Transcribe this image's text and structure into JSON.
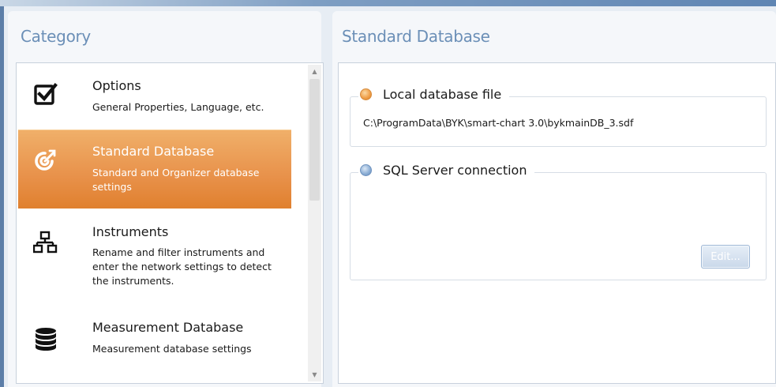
{
  "category": {
    "title": "Category",
    "items": [
      {
        "icon": "checkbox-icon",
        "title": "Options",
        "desc": "General Properties, Language, etc.",
        "selected": false
      },
      {
        "icon": "target-sync-icon",
        "title": "Standard Database",
        "desc": "Standard and Organizer database settings",
        "selected": true
      },
      {
        "icon": "network-icon",
        "title": "Instruments",
        "desc": "Rename and filter instruments and enter the network settings to detect the instruments.",
        "selected": false
      },
      {
        "icon": "database-icon",
        "title": "Measurement Database",
        "desc": "Measurement database settings",
        "selected": false
      }
    ]
  },
  "standard_db": {
    "title": "Standard Database",
    "local": {
      "label": "Local database file",
      "path": "C:\\ProgramData\\BYK\\smart-chart 3.0\\bykmainDB_3.sdf",
      "selected": true
    },
    "sql": {
      "label": "SQL Server connection",
      "selected": false,
      "edit_label": "Edit..."
    }
  },
  "colors": {
    "accent": "#e8914a",
    "title_blue": "#6b8fb7"
  }
}
